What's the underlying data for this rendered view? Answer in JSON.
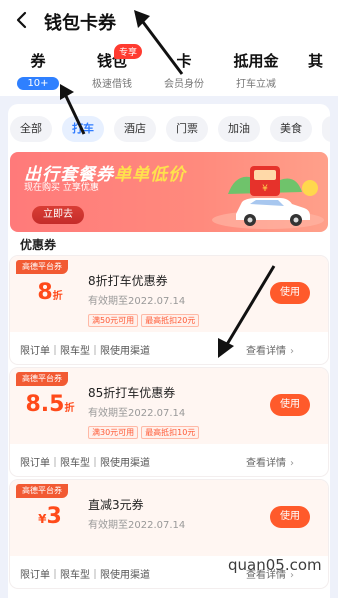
{
  "header": {
    "title": "钱包卡券"
  },
  "tabs": [
    {
      "label": "券",
      "sub": "10+"
    },
    {
      "label": "钱包",
      "sub": "极速借钱",
      "badge": "专享"
    },
    {
      "label": "卡",
      "sub": "会员身份"
    },
    {
      "label": "抵用金",
      "sub": "打车立减"
    },
    {
      "label": "其",
      "sub": ""
    }
  ],
  "filters": [
    "全部",
    "打车",
    "酒店",
    "门票",
    "加油",
    "美食"
  ],
  "active_filter": "打车",
  "banner": {
    "title_a": "出行套餐券",
    "title_b": "单单低价",
    "sub_1": "现在购买 立享优惠",
    "button": "立即去"
  },
  "section_title": "优惠券",
  "coupons": [
    {
      "tag": "高德平台券",
      "amount": "8",
      "unit": "折",
      "name": "8折打车优惠券",
      "valid": "有效期至2022.07.14",
      "tag1": "满50元可用",
      "tag2": "最高抵扣20元",
      "button": "使用",
      "restrict": "限订单｜限车型｜限使用渠道",
      "details": "查看详情"
    },
    {
      "tag": "高德平台券",
      "amount": "8.5",
      "unit": "折",
      "name": "85折打车优惠券",
      "valid": "有效期至2022.07.14",
      "tag1": "满30元可用",
      "tag2": "最高抵扣10元",
      "button": "使用",
      "restrict": "限订单｜限车型｜限使用渠道",
      "details": "查看详情"
    },
    {
      "tag": "高德平台券",
      "prefix": "¥",
      "amount": "3",
      "name": "直减3元券",
      "valid": "有效期至2022.07.14",
      "button": "使用",
      "restrict": "限订单｜限车型｜限使用渠道",
      "details": "查看详情"
    }
  ],
  "watermark": "quan05.com",
  "colors": {
    "accent": "#ff5a2b",
    "tab_blue": "#2f80ff",
    "banner": "#ff7a7a"
  }
}
